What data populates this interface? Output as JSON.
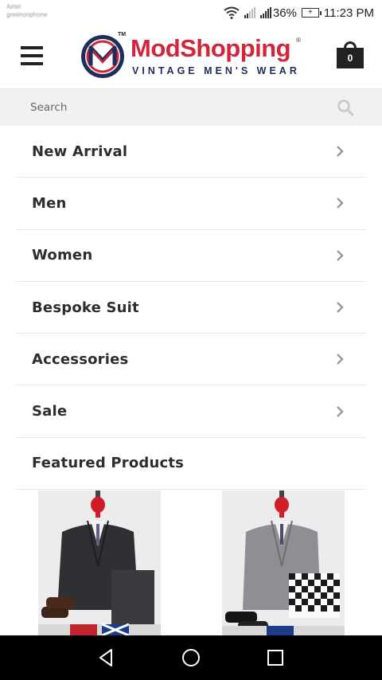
{
  "status_bar": {
    "carrier": "Airtel",
    "carrier_sub": "greenonphone",
    "battery_percent": "36%",
    "time": "11:23 PM"
  },
  "header": {
    "logo": {
      "brand_mod": "Mod",
      "brand_shopping": "Shopping",
      "trademark": "TM",
      "registered": "®",
      "tagline": "VINTAGE MEN'S WEAR"
    },
    "cart_count": "0"
  },
  "search": {
    "placeholder": "Search"
  },
  "menu": {
    "items": [
      {
        "label": "New Arrival"
      },
      {
        "label": "Men"
      },
      {
        "label": "Women"
      },
      {
        "label": "Bespoke Suit"
      },
      {
        "label": "Accessories"
      },
      {
        "label": "Sale"
      }
    ],
    "featured_heading": "Featured Products"
  },
  "products": [
    {
      "name": "Charcoal grey suit"
    },
    {
      "name": "Grey dogtooth suit"
    }
  ],
  "colors": {
    "brand_red": "#d3243a",
    "brand_navy": "#1f2d5a",
    "text_dark": "#2d2d2d",
    "search_bg": "#f1f1f1",
    "divider": "#e8e8e8"
  }
}
